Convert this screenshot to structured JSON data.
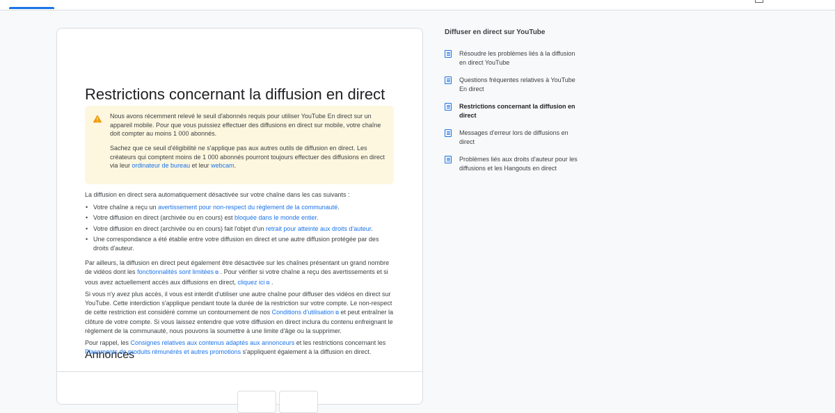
{
  "article": {
    "title": "Restrictions concernant la diffusion en direct",
    "warning": {
      "p1": "Nous avons récemment relevé le seuil d'abonnés requis pour utiliser YouTube En direct sur un appareil mobile. Pour que vous puissiez effectuer des diffusions en direct sur mobile, votre chaîne doit compter au moins 1 000 abonnés.",
      "p2_a": "Sachez que ce seuil d'éligibilité ne s'applique pas aux autres outils de diffusion en direct. Les créateurs qui comptent moins de 1 000 abonnés pourront toujours effectuer des diffusions en direct via leur ",
      "p2_link1": "ordinateur de bureau",
      "p2_b": " et leur ",
      "p2_link2": "webcam",
      "p2_c": "."
    },
    "intro": "La diffusion en direct sera automatiquement désactivée sur votre chaîne dans les cas suivants :",
    "bullets": {
      "b1_a": "Votre chaîne a reçu un ",
      "b1_link": "avertissement pour non-respect du règlement de la communauté",
      "b1_b": ".",
      "b2_a": "Votre diffusion en direct (archivée ou en cours) est ",
      "b2_link": "bloquée dans le monde entier",
      "b2_b": ".",
      "b3_a": "Votre diffusion en direct (archivée ou en cours) fait l'objet d'un ",
      "b3_link": "retrait pour atteinte aux droits d'auteur",
      "b3_b": ".",
      "b4": "Une correspondance a été établie entre votre diffusion en direct et une autre diffusion protégée par des droits d'auteur."
    },
    "para2": {
      "a": "Par ailleurs, la diffusion en direct peut également être désactivée sur les chaînes présentant un grand nombre de vidéos dont les ",
      "link1": "fonctionnalités sont limitées",
      "b": " . Pour vérifier si votre chaîne a reçu des avertissements et si vous avez actuellement accès aux diffusions en direct, ",
      "link2": "cliquez ici",
      "c": " ."
    },
    "para3": {
      "a": "Si vous n'y avez plus accès, il vous est interdit d'utiliser une autre chaîne pour diffuser des vidéos en direct sur YouTube. Cette interdiction s'applique pendant toute la durée de la restriction sur votre compte. Le non-respect de cette restriction est considéré comme un contournement de nos ",
      "link": "Conditions d'utilisation",
      "b": "  et peut entraîner la clôture de votre compte. Si vous laissez entendre que votre diffusion en direct inclura du contenu enfreignant le règlement de la communauté, nous pouvons la soumettre à une limite d'âge ou la supprimer."
    },
    "section_title": "Annonces",
    "para4": {
      "a": "Pour rappel, les ",
      "link1": "Consignes relatives aux contenus adaptés aux annonceurs",
      "b": " et les restrictions concernant les ",
      "link2": "Placements de produits rémunérés et autres promotions",
      "c": " s'appliquent également à la diffusion en direct."
    }
  },
  "sidebar": {
    "title": "Diffuser en direct sur YouTube",
    "items": [
      {
        "label": "Résoudre les problèmes liés à la diffusion en direct YouTube",
        "active": false
      },
      {
        "label": "Questions fréquentes relatives à YouTube En direct",
        "active": false
      },
      {
        "label": "Restrictions concernant la diffusion en direct",
        "active": true
      },
      {
        "label": "Messages d'erreur lors de diffusions en direct",
        "active": false
      },
      {
        "label": "Problèmes liés aux droits d'auteur pour les diffusions et les Hangouts en direct",
        "active": false
      }
    ]
  },
  "colors": {
    "accent": "#1a73e8",
    "warning_bg": "#fef7e0",
    "warning_icon": "#f29900"
  },
  "icons": {
    "warning": "warning-icon",
    "external": "external-link-icon",
    "doc": "doc-icon"
  }
}
